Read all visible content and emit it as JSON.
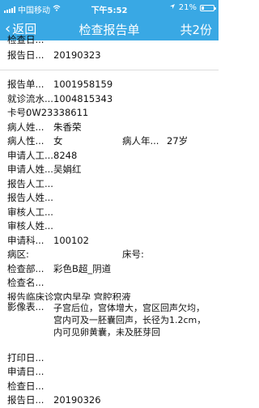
{
  "status": {
    "carrier": "中国移动",
    "time": "下午5:52",
    "battery_percent": "21%",
    "battery_level": 0.21
  },
  "nav": {
    "back_label": "返回",
    "title": "检查报告单",
    "count_label": "共2份"
  },
  "report1": {
    "cutoff_label": "检查日...",
    "report_date_label": "报告日...",
    "report_date": "20190323"
  },
  "report2": {
    "fields": [
      {
        "label": "报告单...",
        "value": "1001958159"
      },
      {
        "label": "就诊流水...",
        "value": "1004815343"
      },
      {
        "label": "卡号: ",
        "value": "0W23338611"
      },
      {
        "label": "病人姓...",
        "value": "朱香荣"
      },
      {
        "label": "病人性...",
        "value": "女"
      },
      {
        "label": "申请人工...",
        "value": "8248"
      },
      {
        "label": "申请人姓...",
        "value": "吴娟红"
      },
      {
        "label": "报告人工...",
        "value": ""
      },
      {
        "label": "报告人姓...",
        "value": ""
      },
      {
        "label": "审核人工...",
        "value": ""
      },
      {
        "label": "审核人姓...",
        "value": ""
      },
      {
        "label": "申请科...",
        "value": "100102"
      },
      {
        "label": "病区:",
        "value": ""
      },
      {
        "label": "检查部...",
        "value": "彩色B超_阴道"
      },
      {
        "label": "检查名...",
        "value": ""
      },
      {
        "label": "报告临床诊...",
        "value": "宫内早孕 宫腔积液"
      },
      {
        "label": "影像表...",
        "value": "子宫后位，宫体增大，宫区回声欠均，宫内可及一胚囊回声，长径为1.2cm，内可见卵黄囊，未及胚芽回"
      },
      {
        "label": "打印日...",
        "value": ""
      },
      {
        "label": "申请日...",
        "value": ""
      },
      {
        "label": "检查日...",
        "value": ""
      },
      {
        "label": "报告日...",
        "value": "20190326"
      }
    ],
    "age_label": "病人年...",
    "age_value": "27岁",
    "bed_label": "床号:"
  }
}
